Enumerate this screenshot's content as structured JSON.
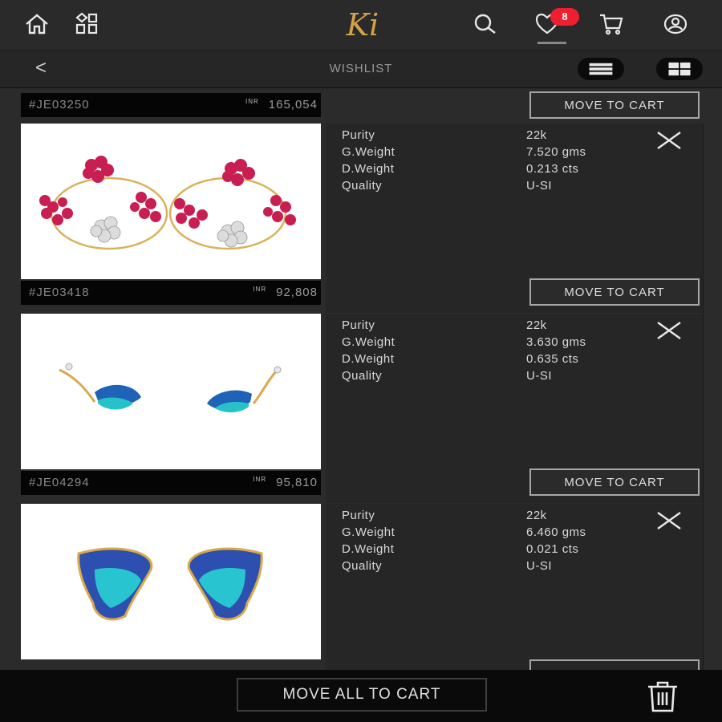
{
  "header": {
    "logo_text": "Ki",
    "wishlist_badge": "8"
  },
  "subheader": {
    "back_label": "<",
    "title": "WISHLIST"
  },
  "previous_item": {
    "code": "#JE03250",
    "currency": "INR",
    "price": "165,054",
    "move_label": "MOVE TO CART"
  },
  "spec_labels": {
    "purity": "Purity",
    "gweight": "G.Weight",
    "dweight": "D.Weight",
    "quality": "Quality"
  },
  "items": [
    {
      "code": "#JE03418",
      "currency": "INR",
      "price": "92,808",
      "purity": "22k",
      "gweight": "7.520 gms",
      "dweight": "0.213 cts",
      "quality": "U-SI",
      "move_label": "MOVE TO CART",
      "image": "flower-ruby-hoop-earrings"
    },
    {
      "code": "#JE04294",
      "currency": "INR",
      "price": "95,810",
      "purity": "22k",
      "gweight": "3.630 gms",
      "dweight": "0.635 cts",
      "quality": "U-SI",
      "move_label": "MOVE TO CART",
      "image": "butterfly-enamel-stud-earrings"
    },
    {
      "purity": "22k",
      "gweight": "6.460 gms",
      "dweight": "0.021 cts",
      "quality": "U-SI",
      "image": "wing-enamel-stud-earrings"
    }
  ],
  "footer": {
    "move_all_label": "MOVE ALL TO CART"
  },
  "colors": {
    "background": "#2b2b2b",
    "badge": "#ee2030",
    "logo_gold": "#d3a24a"
  }
}
